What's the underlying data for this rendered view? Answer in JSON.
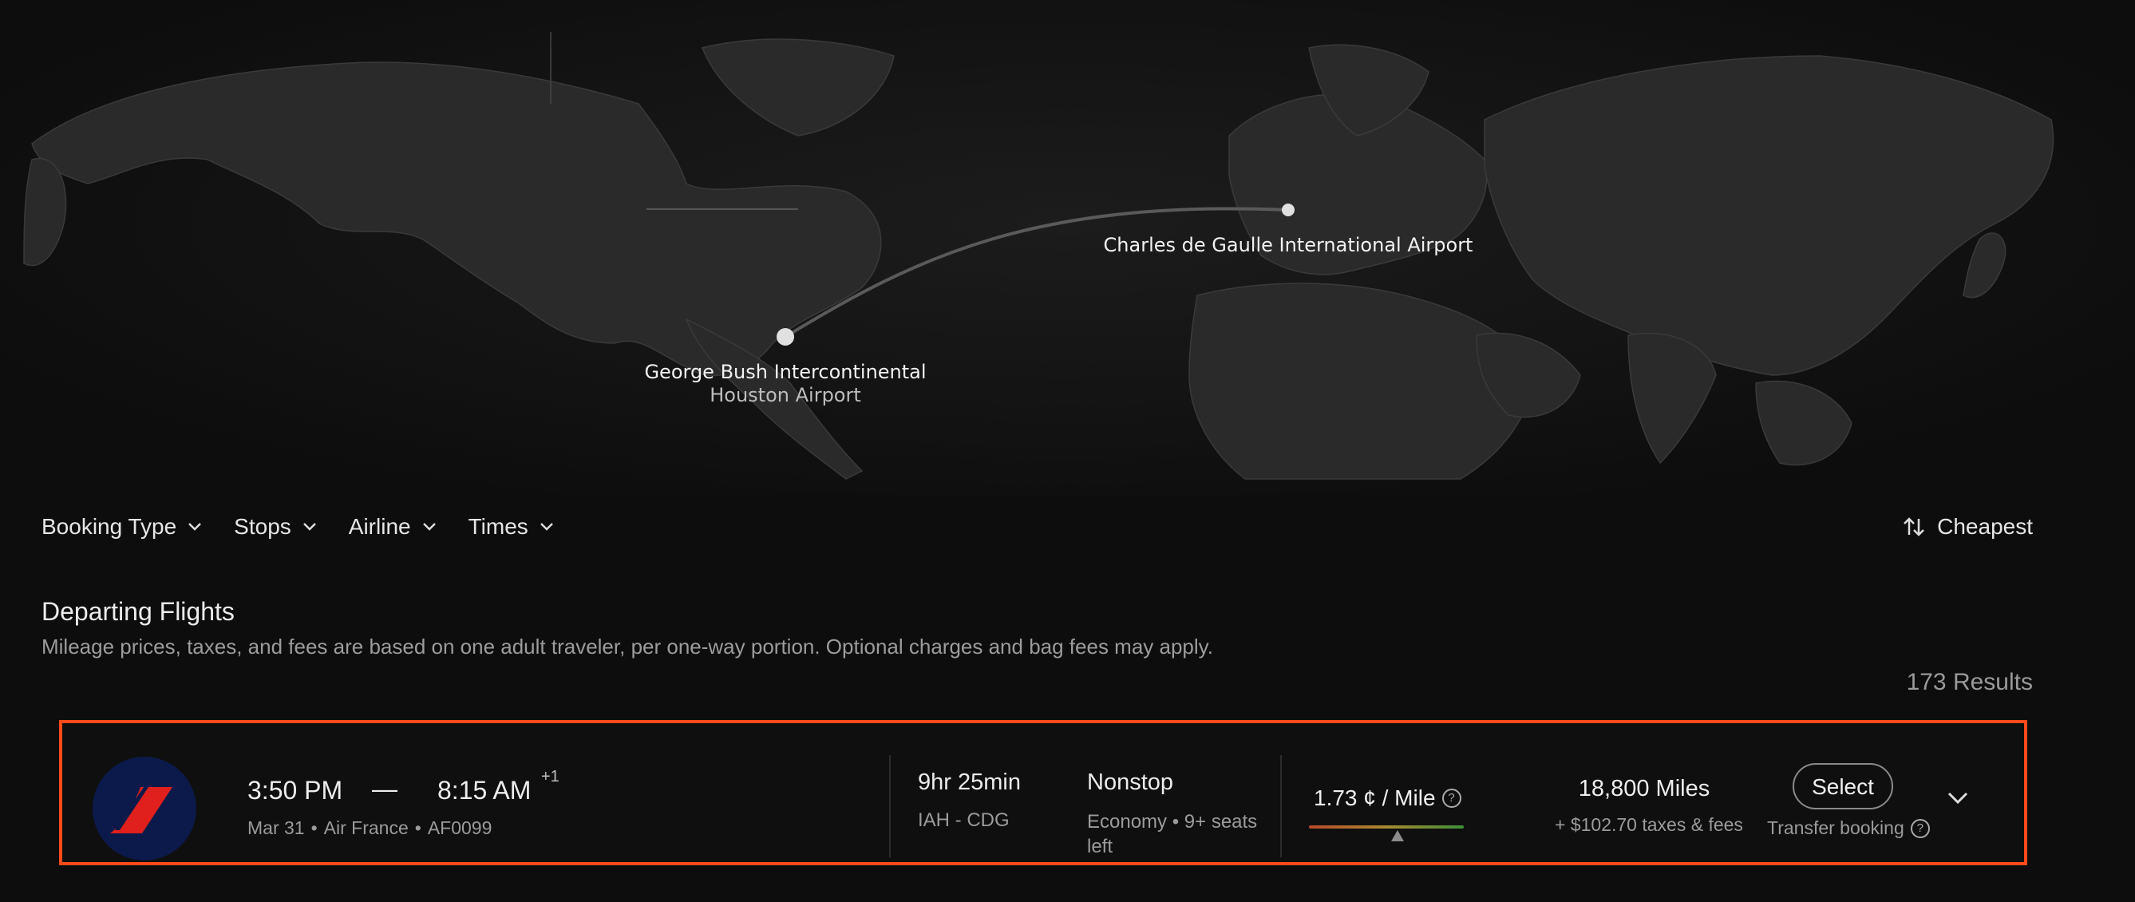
{
  "map": {
    "origin": {
      "name": "George Bush Intercontinental",
      "sub": "Houston Airport"
    },
    "destination": {
      "name": "Charles de Gaulle International Airport"
    }
  },
  "filters": [
    {
      "label": "Booking Type",
      "icon": "chevron-down-icon"
    },
    {
      "label": "Stops",
      "icon": "chevron-down-icon"
    },
    {
      "label": "Airline",
      "icon": "chevron-down-icon"
    },
    {
      "label": "Times",
      "icon": "chevron-down-icon"
    }
  ],
  "sort": {
    "label": "Cheapest",
    "icon": "sort-arrows-icon"
  },
  "section": {
    "title": "Departing Flights",
    "note": "Mileage prices, taxes, and fees are based on one adult traveler, per one-way portion. Optional charges and bag fees may apply.",
    "results": "173 Results"
  },
  "flight": {
    "depart": "3:50 PM",
    "dash": "—",
    "arrive": "8:15 AM",
    "day_offset": "+1",
    "date": "Mar 31",
    "airline": "Air France",
    "flight_no": "AF0099",
    "duration": "9hr 25min",
    "route": "IAH - CDG",
    "stops": "Nonstop",
    "cabin": "Economy • 9+ seats left",
    "cents_per_mile": "1.73 ¢ / Mile",
    "value_position": 0.57,
    "miles": "18,800 Miles",
    "fees": "+ $102.70 taxes & fees",
    "select_label": "Select",
    "transfer_label": "Transfer booking"
  },
  "colors": {
    "accent_border": "#ff4a1c",
    "logo_bg": "#0b1a4a",
    "logo_mark": "#e0201c"
  }
}
